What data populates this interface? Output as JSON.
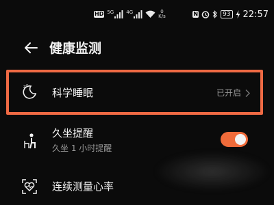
{
  "status_bar": {
    "left": {
      "hd_label": "HD",
      "net1_label": "5G",
      "net2_label": "4G",
      "speed_value": "0",
      "speed_unit": "K/s"
    },
    "right": {
      "nfc_label": "N",
      "battery_level": "93",
      "time": "22:57"
    },
    "icons": [
      "hd-icon",
      "signal-icon",
      "signal-icon",
      "wifi-icon",
      "nfc-icon",
      "alarm-icon",
      "bluetooth-icon",
      "battery-icon",
      "charging-icon"
    ]
  },
  "header": {
    "title": "健康监测"
  },
  "items": [
    {
      "title": "科学睡眠",
      "status": "已开启",
      "icon": "sleep-moon-icon"
    },
    {
      "title": "久坐提醒",
      "subtitle": "久坐 1 小时提醒",
      "icon": "sedentary-person-icon",
      "toggle_on": true
    },
    {
      "title": "连续测量心率",
      "icon": "heart-rate-icon"
    }
  ],
  "colors": {
    "background": "#0b0b0b",
    "accent": "#f06b3a",
    "highlight_border": "#ef6a44",
    "secondary_text": "#9a9a9a"
  }
}
